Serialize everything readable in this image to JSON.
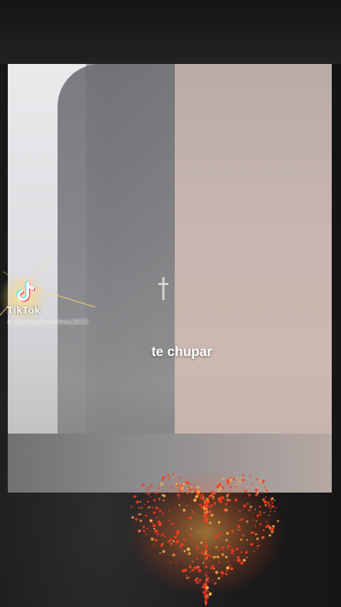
{
  "overlay": {
    "watermark_brand": "TikTok",
    "watermark_user": "@gonzalomartinez2022",
    "caption": "te chupar"
  },
  "icons": {
    "watermark_logo": "tiktok-note-icon",
    "user_glyph": "person-icon",
    "earring": "cross-icon",
    "sticker": "sparkling-heart"
  },
  "colors": {
    "heart": "#ff3a1c",
    "heart_glow": "#ffb347",
    "caption_text": "#ffffff",
    "tiktok_cyan": "#25f4ee",
    "tiktok_pink": "#fe2c55"
  }
}
